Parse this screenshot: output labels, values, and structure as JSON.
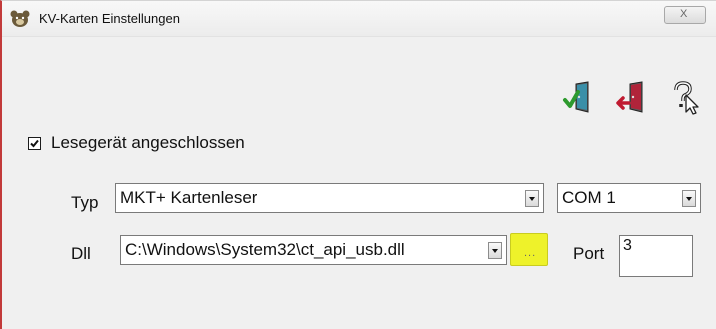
{
  "window": {
    "title": "KV-Karten Einstellungen",
    "close_label": "X"
  },
  "toolbar": {
    "icons": [
      "door-checkmark-icon",
      "door-exit-icon",
      "help-pointer-icon"
    ]
  },
  "reader": {
    "connected_checked": true,
    "connected_label": "Lesegerät angeschlossen"
  },
  "form": {
    "type_label": "Typ",
    "type_value": "MKT+ Kartenleser",
    "com_value": "COM 1",
    "dll_label": "Dll",
    "dll_value": "C:\\Windows\\System32\\ct_api_usb.dll",
    "browse_label": "...",
    "port_label": "Port",
    "port_value": "3"
  },
  "colors": {
    "browse_highlight": "#eef22a",
    "window_border_accent": "#c23a3a"
  }
}
